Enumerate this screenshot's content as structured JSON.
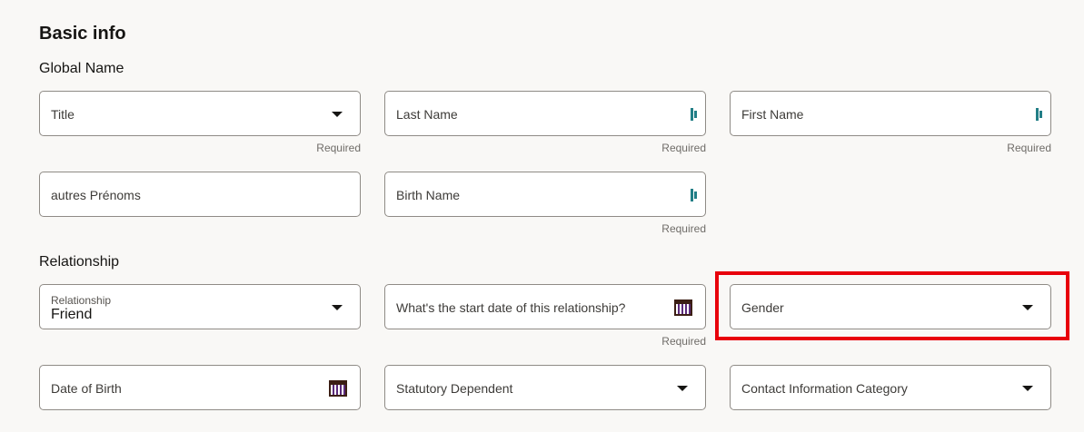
{
  "title": "Basic info",
  "sections": {
    "global_name": "Global Name",
    "relationship": "Relationship"
  },
  "required": "Required",
  "fields": {
    "title": "Title",
    "last_name": "Last Name",
    "first_name": "First Name",
    "autres_prenoms": "autres Prénoms",
    "birth_name": "Birth Name",
    "relationship_label": "Relationship",
    "relationship_value": "Friend",
    "start_date": "What's the start date of this relationship?",
    "gender": "Gender",
    "date_of_birth": "Date of Birth",
    "statutory_dependent": "Statutory Dependent",
    "contact_info_category": "Contact Information Category"
  }
}
